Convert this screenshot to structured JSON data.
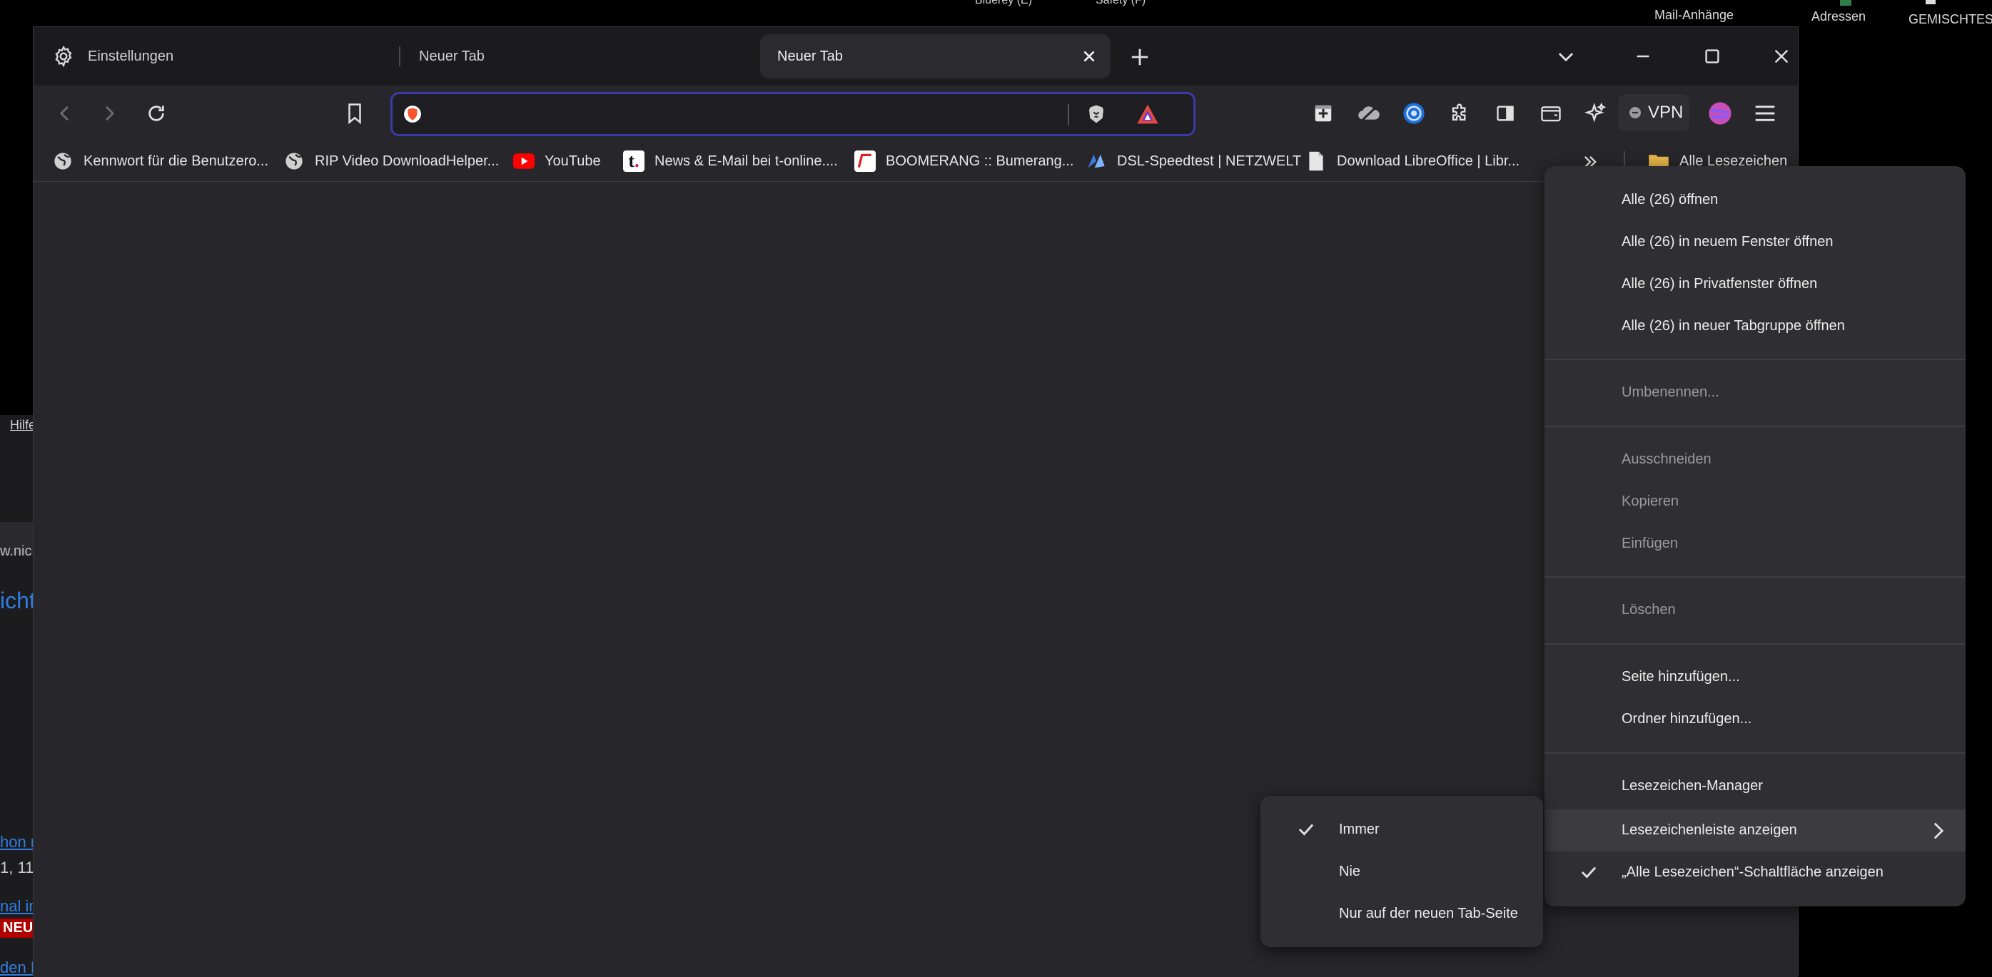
{
  "desktop": {
    "top_cut": [
      "Bluerey (E)",
      "Safety (F)"
    ],
    "icons": [
      "Mail-Anhänge",
      "Adressen",
      "GEMISCHTES"
    ]
  },
  "background_window": {
    "menu_item": "Hilfe",
    "url_fragment": "w.nic",
    "link_fragment": "icht",
    "text1": "hon n",
    "text2": "1, 11:",
    "text3": "nal in",
    "badge": "NEU",
    "text4": "den B"
  },
  "tabs": [
    {
      "label": "Einstellungen",
      "icon": "gear-icon"
    },
    {
      "label": "Neuer Tab"
    },
    {
      "label": "Neuer Tab",
      "active": true
    }
  ],
  "address_bar": {
    "value": "",
    "placeholder": ""
  },
  "toolbar": {
    "vpn_label": "VPN"
  },
  "bookmarks": [
    {
      "label": "Kennwort für die Benutzero...",
      "icon": "globe-icon"
    },
    {
      "label": "RIP Video DownloadHelper...",
      "icon": "globe-icon"
    },
    {
      "label": "YouTube",
      "icon": "youtube-icon"
    },
    {
      "label": "News & E-Mail bei t-online....",
      "icon": "t-online-icon"
    },
    {
      "label": "BOOMERANG :: Bumerang...",
      "icon": "boomerang-icon"
    },
    {
      "label": "DSL-Speedtest | NETZWELT",
      "icon": "netzwelt-icon"
    },
    {
      "label": "Download LibreOffice | Libr...",
      "icon": "document-icon"
    }
  ],
  "all_bookmarks_label": "Alle Lesezeichen",
  "context_menu": {
    "items": [
      {
        "label": "Alle (26) öffnen",
        "enabled": true
      },
      {
        "label": "Alle (26) in neuem Fenster öffnen",
        "enabled": true
      },
      {
        "label": "Alle (26) in Privatfenster öffnen",
        "enabled": true
      },
      {
        "label": "Alle (26) in neuer Tabgruppe öffnen",
        "enabled": true
      },
      {
        "label": "Umbenennen...",
        "enabled": false
      },
      {
        "label": "Ausschneiden",
        "enabled": false
      },
      {
        "label": "Kopieren",
        "enabled": false
      },
      {
        "label": "Einfügen",
        "enabled": false
      },
      {
        "label": "Löschen",
        "enabled": false
      },
      {
        "label": "Seite hinzufügen...",
        "enabled": true
      },
      {
        "label": "Ordner hinzufügen...",
        "enabled": true
      },
      {
        "label": "Lesezeichen-Manager",
        "enabled": true
      },
      {
        "label": "Lesezeichenleiste anzeigen",
        "enabled": true,
        "submenu": true,
        "highlighted": true
      },
      {
        "label": "„Alle Lesezeichen“-Schaltfläche anzeigen",
        "enabled": true,
        "checked": true
      }
    ]
  },
  "submenu": {
    "items": [
      {
        "label": "Immer",
        "checked": true
      },
      {
        "label": "Nie",
        "checked": false
      },
      {
        "label": "Nur auf der neuen Tab-Seite",
        "checked": false
      }
    ]
  },
  "colors": {
    "tabstrip_bg": "#1b1b1e",
    "toolbar_bg": "#27272b",
    "url_focus_border": "#3d3aa5",
    "menu_bg": "#2f2f33",
    "brave_orange": "#fb542b"
  }
}
